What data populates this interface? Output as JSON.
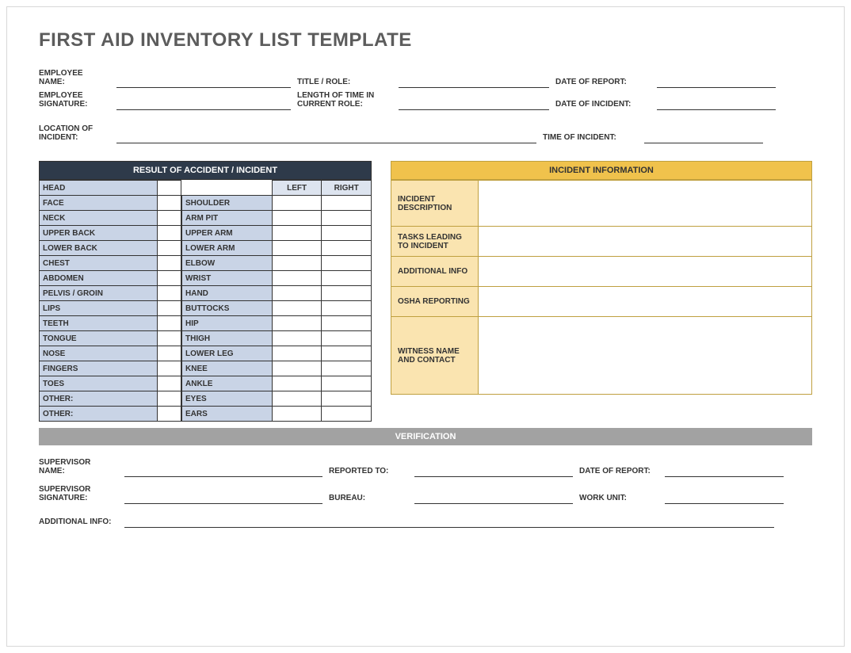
{
  "title": "FIRST AID INVENTORY LIST TEMPLATE",
  "employee": {
    "name_label": "EMPLOYEE NAME:",
    "title_label": "TITLE / ROLE:",
    "date_report_label": "DATE OF REPORT:",
    "signature_label": "EMPLOYEE SIGNATURE:",
    "length_label": "LENGTH OF TIME IN CURRENT ROLE:",
    "date_incident_label": "DATE OF INCIDENT:",
    "location_label": "LOCATION OF INCIDENT:",
    "time_label": "TIME OF INCIDENT:"
  },
  "result": {
    "header": "RESULT OF ACCIDENT / INCIDENT",
    "left_header": "LEFT",
    "right_header": "RIGHT",
    "body_parts_a": [
      "HEAD",
      "FACE",
      "NECK",
      "UPPER BACK",
      "LOWER BACK",
      "CHEST",
      "ABDOMEN",
      "PELVIS / GROIN",
      "LIPS",
      "TEETH",
      "TONGUE",
      "NOSE",
      "FINGERS",
      "TOES",
      "OTHER:",
      "OTHER:"
    ],
    "body_parts_b": [
      "SHOULDER",
      "ARM PIT",
      "UPPER ARM",
      "LOWER ARM",
      "ELBOW",
      "WRIST",
      "HAND",
      "BUTTOCKS",
      "HIP",
      "THIGH",
      "LOWER LEG",
      "KNEE",
      "ANKLE",
      "EYES",
      "EARS"
    ]
  },
  "incident": {
    "header": "INCIDENT INFORMATION",
    "rows": [
      {
        "label": "INCIDENT DESCRIPTION",
        "cls": "h58"
      },
      {
        "label": "TASKS LEADING TO INCIDENT",
        "cls": "h38"
      },
      {
        "label": "ADDITIONAL INFO",
        "cls": "h38"
      },
      {
        "label": "OSHA REPORTING",
        "cls": "h38"
      },
      {
        "label": "WITNESS NAME AND CONTACT",
        "cls": "h98"
      }
    ]
  },
  "verification": {
    "header": "VERIFICATION",
    "supervisor_name_label": "SUPERVISOR NAME:",
    "reported_to_label": "REPORTED TO:",
    "date_report_label": "DATE OF REPORT:",
    "supervisor_sig_label": "SUPERVISOR SIGNATURE:",
    "bureau_label": "BUREAU:",
    "work_unit_label": "WORK UNIT:",
    "additional_label": "ADDITIONAL INFO:"
  }
}
